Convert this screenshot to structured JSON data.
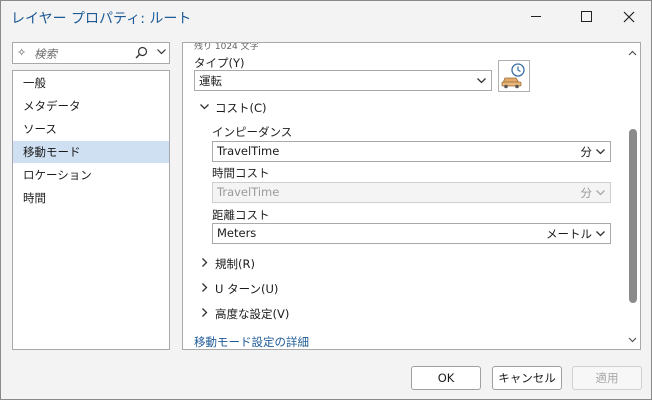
{
  "window": {
    "title": "レイヤー プロパティ: ルート"
  },
  "search": {
    "placeholder": "検索"
  },
  "nav": {
    "items": [
      {
        "label": "一般"
      },
      {
        "label": "メタデータ"
      },
      {
        "label": "ソース"
      },
      {
        "label": "移動モード",
        "selected": true
      },
      {
        "label": "ロケーション"
      },
      {
        "label": "時間"
      }
    ]
  },
  "panel": {
    "cut_text": "残り 1024 文字",
    "type_label": "タイプ(Y)",
    "type_value": "運転",
    "cost_section": "コスト(C)",
    "impedance_label": "インピーダンス",
    "impedance_value": "TravelTime",
    "impedance_unit": "分",
    "time_cost_label": "時間コスト",
    "time_cost_value": "TravelTime",
    "time_cost_unit": "分",
    "distance_cost_label": "距離コスト",
    "distance_cost_value": "Meters",
    "distance_cost_unit": "メートル",
    "restrictions_section": "規制(R)",
    "uturn_section": "U ターン(U)",
    "advanced_section": "高度な設定(V)",
    "link_text": "移動モード設定の詳細"
  },
  "buttons": {
    "ok": "OK",
    "cancel": "キャンセル",
    "apply": "適用"
  },
  "colors": {
    "accent": "#1e5a96",
    "selected_bg": "#cfe0f3"
  }
}
